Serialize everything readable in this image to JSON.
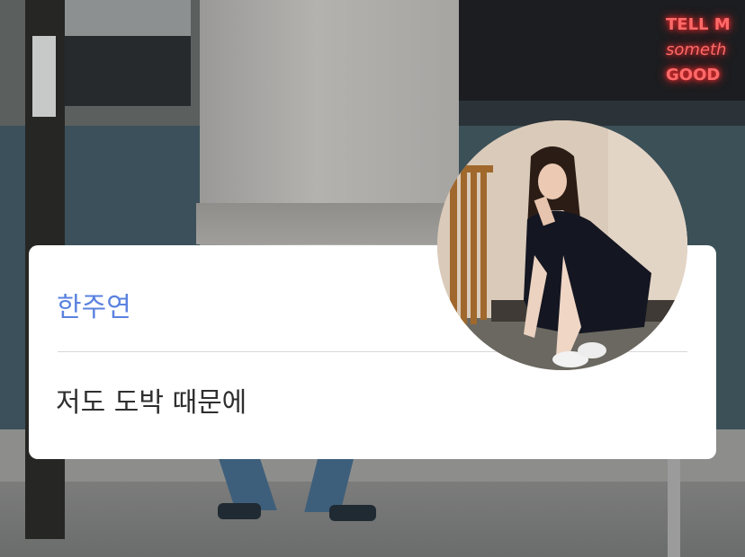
{
  "background": {
    "neon_sign": [
      "TELL M",
      "someth",
      "GOOD"
    ]
  },
  "post": {
    "author_name": "한주연",
    "message": "저도 도박 때문에",
    "avatar": "profile-photo",
    "name_color": "#5b82e0",
    "text_color": "#2f2f2f",
    "card_background": "#ffffff"
  }
}
